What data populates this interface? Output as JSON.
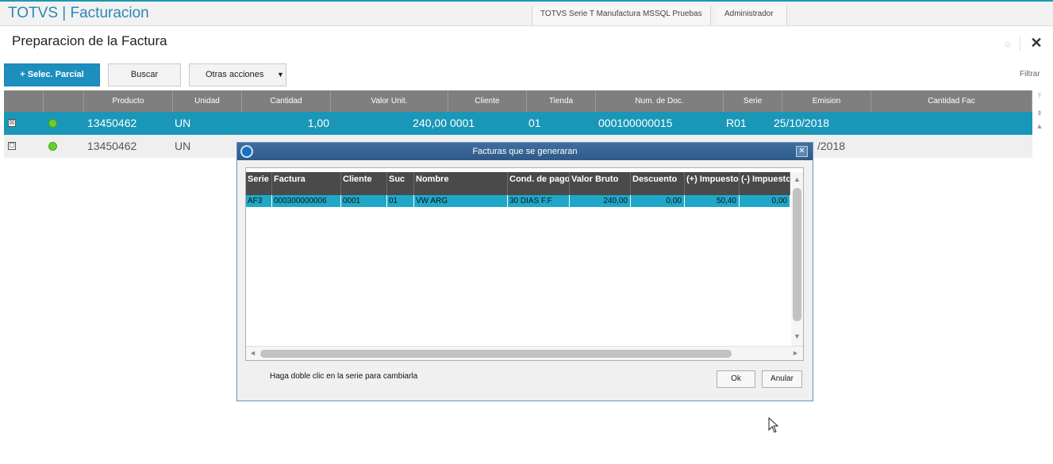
{
  "app": {
    "title": "TOTVS | Facturacion",
    "environment": "TOTVS Serie T Manufactura MSSQL Pruebas",
    "user": "Administrador"
  },
  "page": {
    "title": "Preparacion de la Factura",
    "filter_label": "Filtrar"
  },
  "toolbar": {
    "partial_select": "+ Selec. Parcial",
    "search": "Buscar",
    "other_actions": "Otras acciones"
  },
  "grid": {
    "columns": [
      "Producto",
      "Unidad",
      "Cantidad",
      "Valor Unit.",
      "Cliente",
      "Tienda",
      "Num. de Doc.",
      "Serie",
      "Emision",
      "Cantidad Fac"
    ],
    "rows": [
      {
        "checked": "☒",
        "producto": "13450462",
        "unidad": "UN",
        "cantidad": "1,00",
        "valor_unit": "240,00",
        "cliente": "0001",
        "tienda": "01",
        "num_doc": "000100000015",
        "serie": "R01",
        "emision": "25/10/2018"
      },
      {
        "checked": "☐",
        "producto": "13450462",
        "unidad": "UN",
        "emision_partial": "/2018"
      }
    ]
  },
  "dialog": {
    "title": "Facturas que se generaran",
    "columns": [
      "Serie",
      "Factura",
      "Cliente",
      "Suc",
      "Nombre",
      "Cond. de pago",
      "Valor Bruto",
      "Descuento",
      "(+) Impuesto",
      "(-) Impuesto"
    ],
    "row": {
      "serie": "AF3",
      "factura": "000300000006",
      "cliente": "0001",
      "suc": "01",
      "nombre": "VW ARG",
      "cond_pago": "30 DIAS F.F",
      "valor_bruto": "240,00",
      "descuento": "0,00",
      "impuesto_mas": "50,40",
      "impuesto_menos": "0,00"
    },
    "hint": "Haga doble clic en la serie para cambiarla",
    "ok": "Ok",
    "cancel": "Anular"
  },
  "colors": {
    "accent": "#1d8fbf",
    "selected_row": "#1a97b8",
    "dialog_title": "#3f6e9f",
    "dialog_row": "#1fa7c8",
    "status_green": "#6bd12a"
  }
}
